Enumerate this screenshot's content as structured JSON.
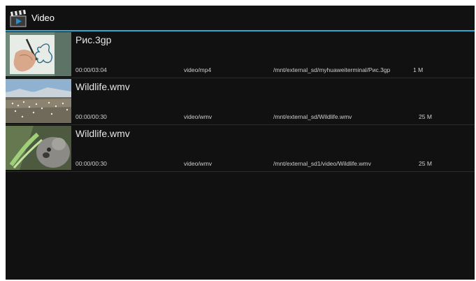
{
  "header": {
    "title": "Video",
    "icon": "clapperboard-icon"
  },
  "colors": {
    "accent": "#2ca9d6",
    "background": "#111111"
  },
  "videos": [
    {
      "name": "Рис.3gp",
      "duration": "00:00/03:04",
      "type": "video/mp4",
      "path": "/mnt/external_sd/myhuaweiterminal/Рис.3gp",
      "size": "1 M",
      "thumbnail": "drawing-hand"
    },
    {
      "name": "Wildlife.wmv",
      "duration": "00:00/00:30",
      "type": "video/wmv",
      "path": "/mnt/external_sd/Wildlife.wmv",
      "size": "25 M",
      "thumbnail": "landscape-birds"
    },
    {
      "name": "Wildlife.wmv",
      "duration": "00:00/00:30",
      "type": "video/wmv",
      "path": "/mnt/external_sd1/video/Wildlife.wmv",
      "size": "25 M",
      "thumbnail": "koala-leaves"
    }
  ]
}
